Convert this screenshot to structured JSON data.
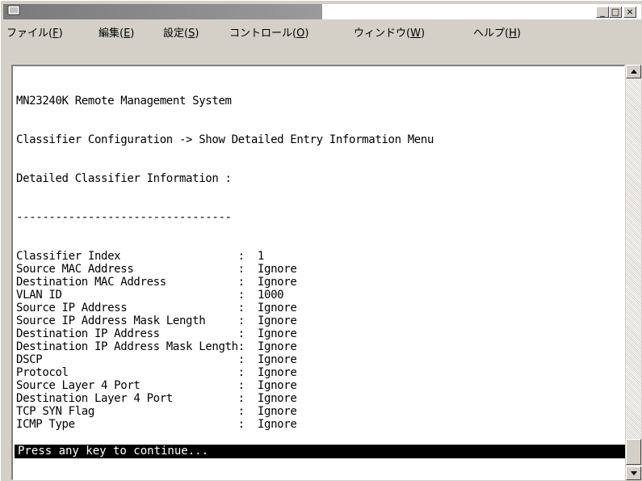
{
  "window": {
    "icon": "terminal-app-icon",
    "min_glyph": "_",
    "max_glyph": "□",
    "close_glyph": "×"
  },
  "menu": {
    "items": [
      {
        "label": "ファイル(",
        "key": "F",
        "end": ")"
      },
      {
        "label": "編集(",
        "key": "E",
        "end": ")"
      },
      {
        "label": "設定(",
        "key": "S",
        "end": ")"
      },
      {
        "label": "コントロール(",
        "key": "O",
        "end": ")"
      },
      {
        "label": "ウィンドウ(",
        "key": "W",
        "end": ")"
      },
      {
        "label": "ヘルプ(",
        "key": "H",
        "end": ")"
      }
    ]
  },
  "terminal": {
    "header": [
      "MN23240K Remote Management System",
      "Classifier Configuration -> Show Detailed Entry Information Menu",
      "Detailed Classifier Information :",
      "---------------------------------"
    ],
    "fields": [
      {
        "name": "Classifier Index",
        "value": "1"
      },
      {
        "name": "Source MAC Address",
        "value": "Ignore"
      },
      {
        "name": "Destination MAC Address",
        "value": "Ignore"
      },
      {
        "name": "VLAN ID",
        "value": "1000"
      },
      {
        "name": "Source IP Address",
        "value": "Ignore"
      },
      {
        "name": "Source IP Address Mask Length",
        "value": "Ignore"
      },
      {
        "name": "Destination IP Address",
        "value": "Ignore"
      },
      {
        "name": "Destination IP Address Mask Length",
        "value": "Ignore"
      },
      {
        "name": "DSCP",
        "value": "Ignore"
      },
      {
        "name": "Protocol",
        "value": "Ignore"
      },
      {
        "name": "Source Layer 4 Port",
        "value": "Ignore"
      },
      {
        "name": "Destination Layer 4 Port",
        "value": "Ignore"
      },
      {
        "name": "TCP SYN Flag",
        "value": "Ignore"
      },
      {
        "name": "ICMP Type",
        "value": "Ignore"
      }
    ],
    "status": "Press any key to continue..."
  }
}
